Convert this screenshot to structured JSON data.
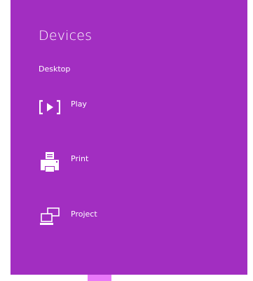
{
  "pane": {
    "title": "Devices",
    "section": "Desktop"
  },
  "items": [
    {
      "label": "Play",
      "icon": "play-icon"
    },
    {
      "label": "Print",
      "icon": "printer-icon"
    },
    {
      "label": "Project",
      "icon": "project-icon"
    }
  ],
  "colors": {
    "pane_background": "#a22ec1",
    "text": "#ffffff",
    "accent_strip": "#e879f9"
  }
}
